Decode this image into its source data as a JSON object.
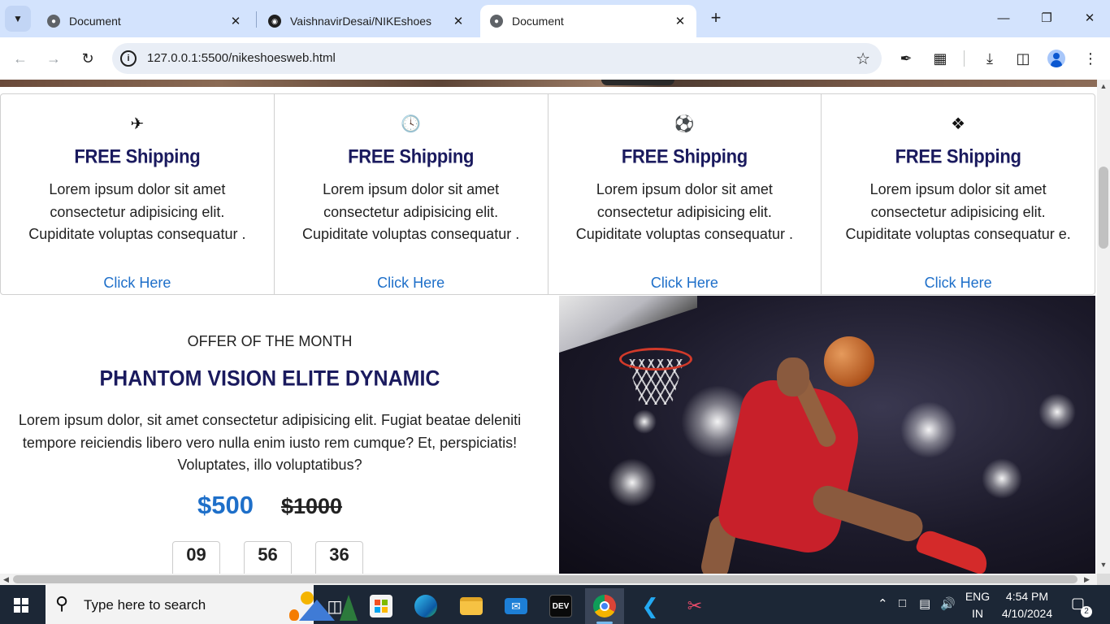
{
  "browser": {
    "tabs": [
      {
        "title": "Document",
        "favicon": "globe-icon"
      },
      {
        "title": "VaishnavirDesai/NIKEshoes",
        "favicon": "github-icon"
      },
      {
        "title": "Document",
        "favicon": "globe-icon",
        "active": true
      }
    ],
    "url": "127.0.0.1:5500/nikeshoesweb.html"
  },
  "features": [
    {
      "icon": "airplane-icon",
      "title": "FREE Shipping",
      "text": "Lorem ipsum dolor sit amet consectetur adipisicing elit. Cupiditate voluptas consequatur .",
      "link": "Click Here"
    },
    {
      "icon": "clock-icon",
      "title": "FREE Shipping",
      "text": "Lorem ipsum dolor sit amet consectetur adipisicing elit. Cupiditate voluptas consequatur .",
      "link": "Click Here"
    },
    {
      "icon": "soccer-ball-icon",
      "title": "FREE Shipping",
      "text": "Lorem ipsum dolor sit amet consectetur adipisicing elit. Cupiditate voluptas consequatur .",
      "link": "Click Here"
    },
    {
      "icon": "dropbox-icon",
      "title": "FREE Shipping",
      "text": "Lorem ipsum dolor sit amet consectetur adipisicing elit. Cupiditate voluptas consequatur e.",
      "link": "Click Here"
    }
  ],
  "offer": {
    "kicker": "OFFER OF THE MONTH",
    "title": "PHANTOM VISION ELITE DYNAMIC",
    "text": "Lorem ipsum dolor, sit amet consectetur adipisicing elit. Fugiat beatae deleniti tempore reiciendis libero vero nulla enim iusto rem cumque? Et, perspiciatis! Voluptates, illo voluptatibus?",
    "price_new": "$500",
    "price_old": "$1000",
    "timer": [
      "09",
      "56",
      "36"
    ]
  },
  "taskbar": {
    "search_placeholder": "Type here to search",
    "lang_top": "ENG",
    "lang_bottom": "IN",
    "time": "4:54 PM",
    "date": "4/10/2024",
    "notification_count": "2",
    "dev_label": "DEV"
  },
  "colors": {
    "heading": "#1a1a5e",
    "link": "#1e6fc9",
    "tabbar": "#d3e3fd",
    "taskbar": "#1c2736"
  }
}
